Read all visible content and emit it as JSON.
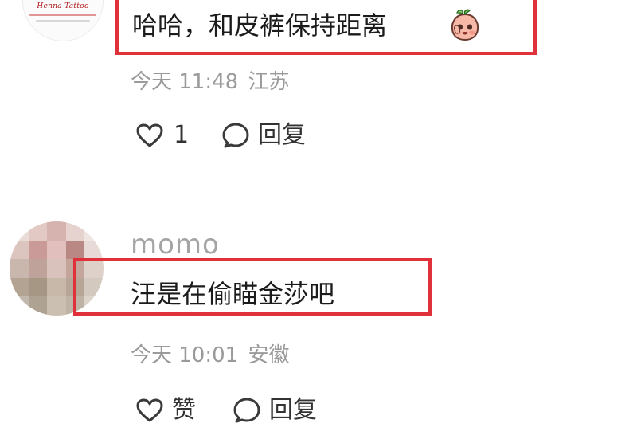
{
  "comments": [
    {
      "avatar": {
        "brand_text": "Henna Tattoo",
        "icon": "brand-logo-avatar"
      },
      "text": "哈哈，和皮裤保持距离",
      "emoji": "peach-face-emoji",
      "time": "今天 11:48",
      "location": "江苏",
      "like_count": "1",
      "reply_label": "回复",
      "highlighted": true
    },
    {
      "username": "momo",
      "avatar": {
        "icon": "pixelated-avatar"
      },
      "text": "汪是在偷瞄金莎吧",
      "time": "今天 10:01",
      "location": "安徽",
      "like_label": "赞",
      "reply_label": "回复",
      "highlighted": true
    }
  ],
  "colors": {
    "highlight": "#e0303a",
    "meta_text": "#9a9a9a",
    "body_text": "#1b1b1b"
  }
}
